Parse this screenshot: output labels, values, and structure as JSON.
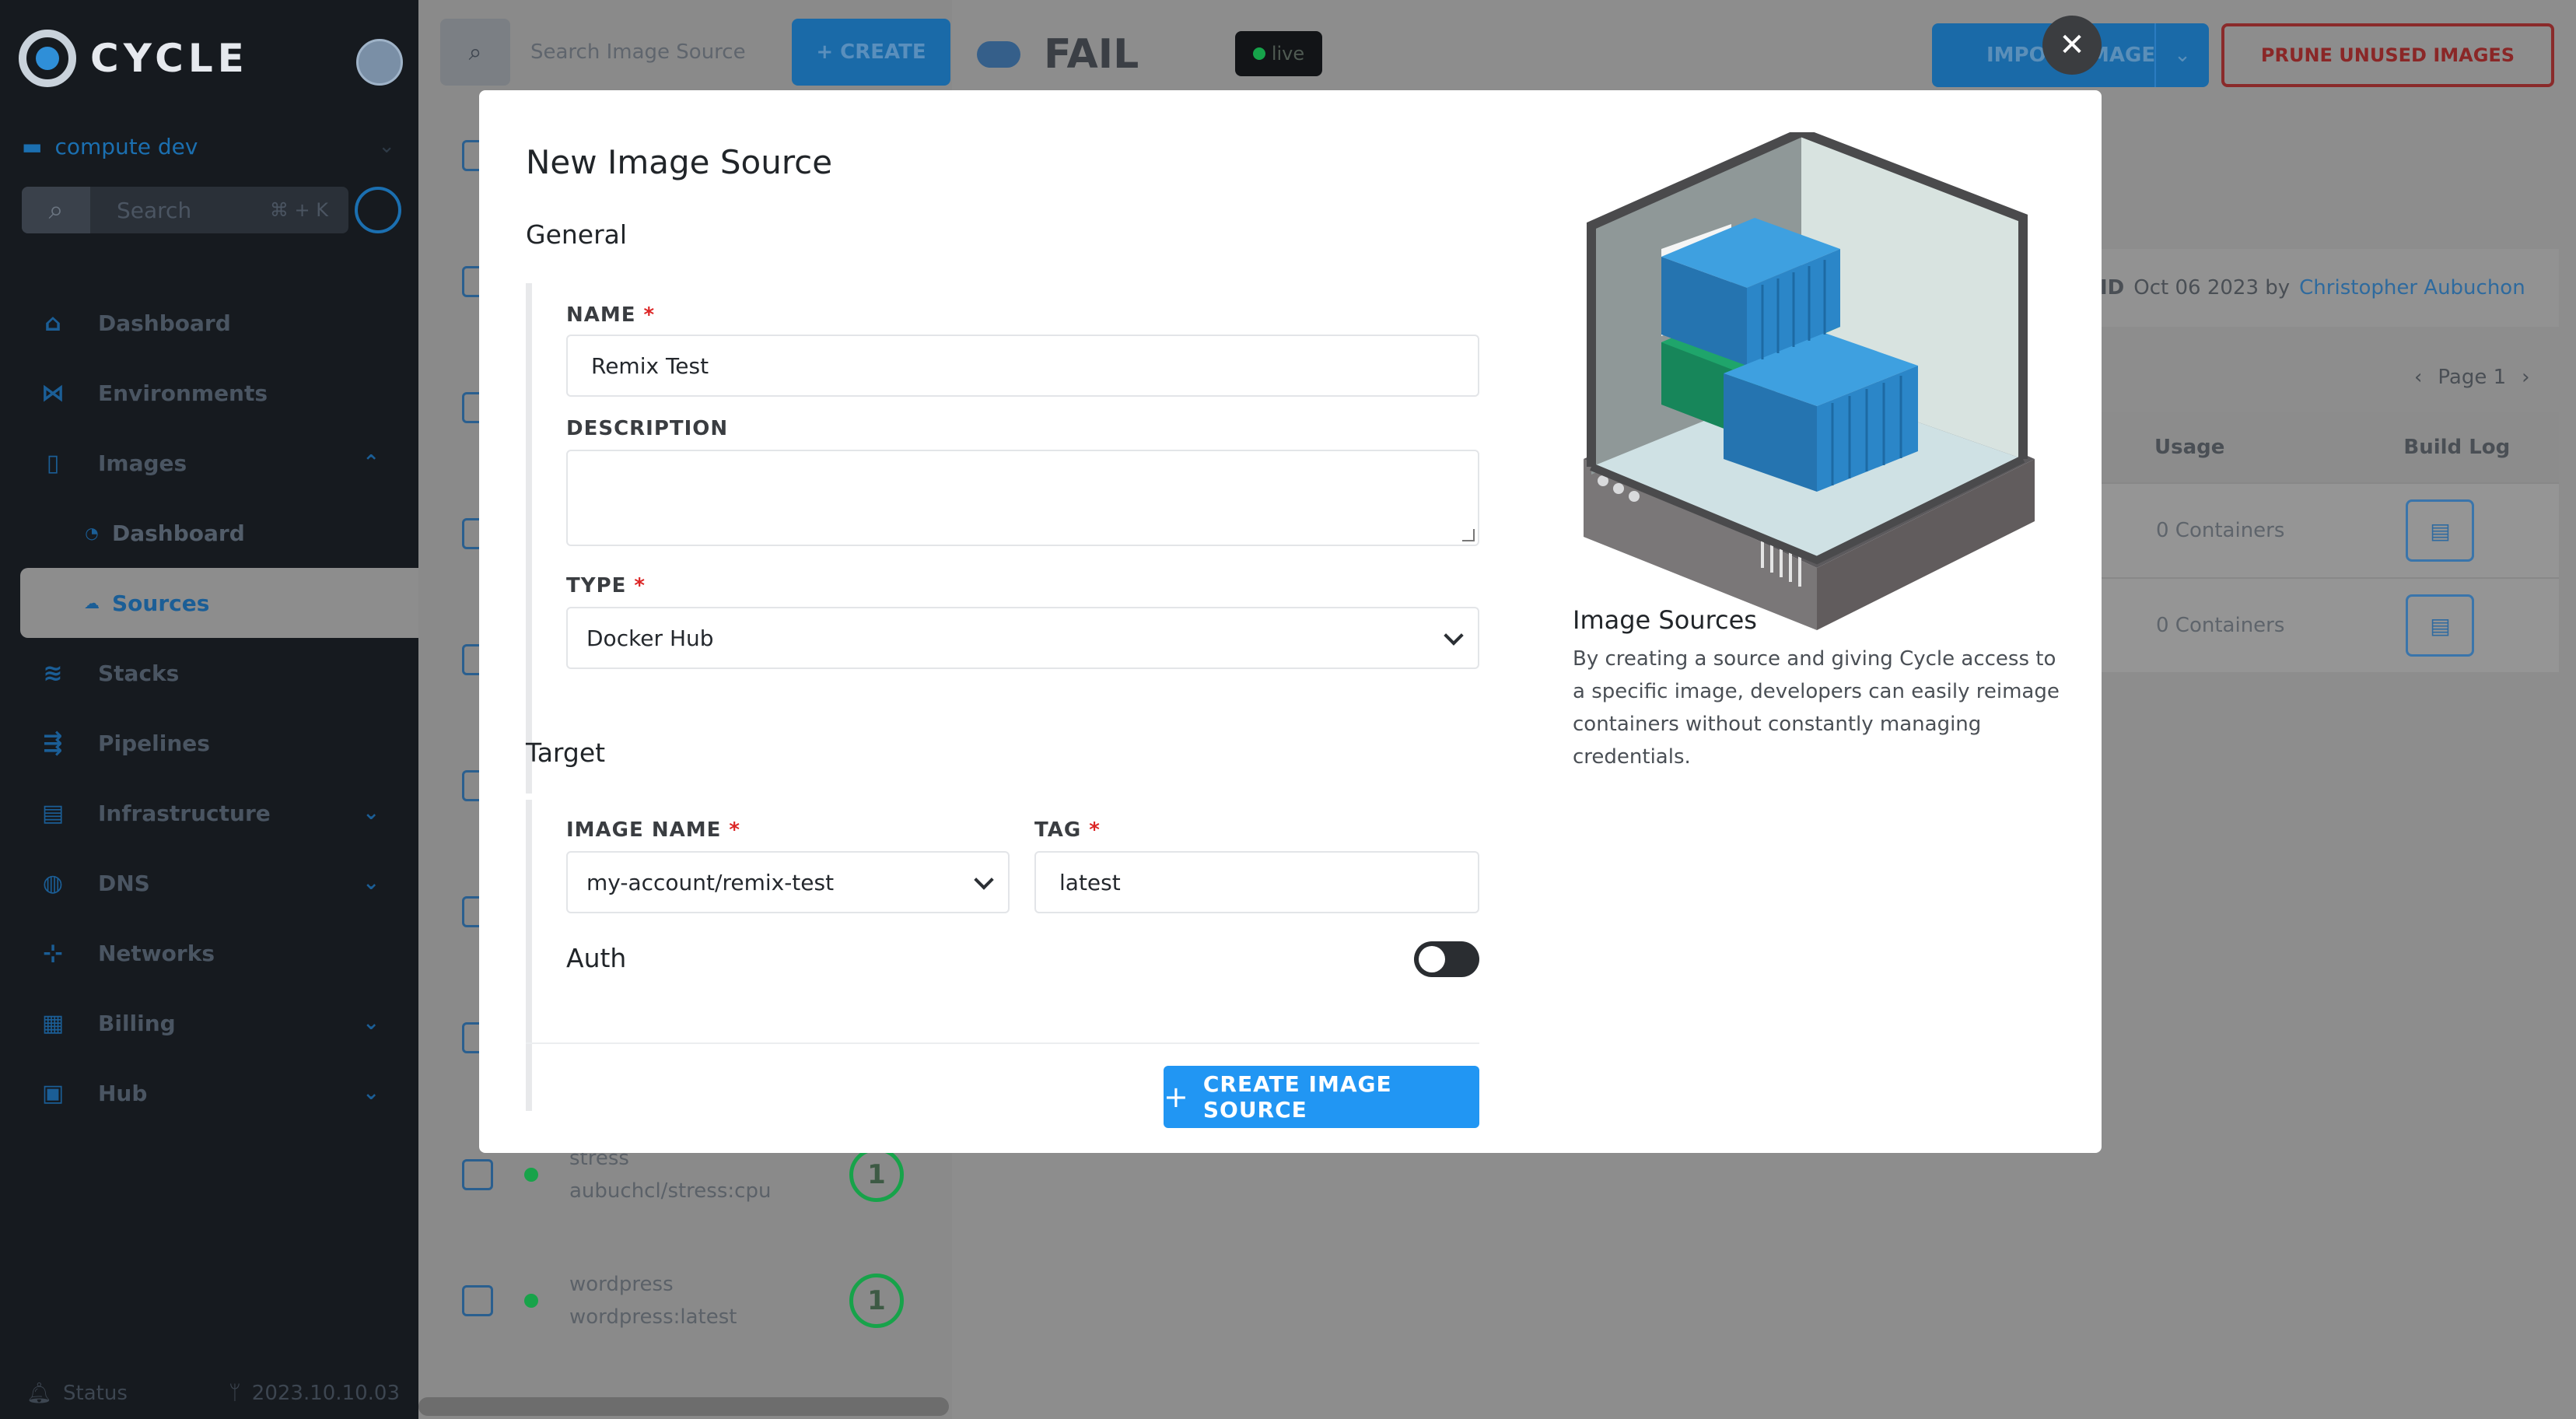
{
  "app": {
    "logo_text": "CYCLE",
    "environment": "compute dev",
    "search_placeholder": "Search",
    "search_shortcut": "⌘ + K",
    "nav": [
      {
        "label": "Dashboard",
        "icon": "home-icon"
      },
      {
        "label": "Environments",
        "icon": "environments-icon"
      },
      {
        "label": "Images",
        "icon": "images-icon",
        "expanded": true
      },
      {
        "label": "Dashboard",
        "icon": "dashboard-icon",
        "sub": true
      },
      {
        "label": "Sources",
        "icon": "cloud-icon",
        "sub": true,
        "active": true
      },
      {
        "label": "Stacks",
        "icon": "stacks-icon"
      },
      {
        "label": "Pipelines",
        "icon": "pipelines-icon"
      },
      {
        "label": "Infrastructure",
        "icon": "infrastructure-icon"
      },
      {
        "label": "DNS",
        "icon": "dns-icon"
      },
      {
        "label": "Networks",
        "icon": "networks-icon"
      },
      {
        "label": "Billing",
        "icon": "billing-icon"
      },
      {
        "label": "Hub",
        "icon": "hub-icon"
      }
    ],
    "footer": {
      "status": "Status",
      "version": "2023.10.10.03"
    }
  },
  "list": {
    "search_placeholder": "Search Image Source",
    "create_label": "+ CREATE",
    "rows": [
      {
        "name": "stress",
        "image": "aubuchcl/stress:cpu",
        "count": "1"
      },
      {
        "name": "wordpress",
        "image": "wordpress:latest",
        "count": "1"
      }
    ]
  },
  "detail": {
    "title": "FAIL",
    "live_label": "live",
    "import_label": "IMPORT IMAGE",
    "prune_label": "PRUNE UNUSED IMAGES",
    "meta_prefix": "ID",
    "meta_date": "Oct 06 2023 by",
    "meta_author": "Christopher Aubuchon",
    "page_label": "Page 1",
    "columns": {
      "usage": "Usage",
      "build_log": "Build Log"
    },
    "rows": [
      {
        "usage": "0 Containers"
      },
      {
        "usage": "0 Containers"
      }
    ]
  },
  "modal": {
    "title": "New Image Source",
    "general_title": "General",
    "name_label": "NAME",
    "name_value": "Remix Test",
    "description_label": "DESCRIPTION",
    "description_value": "",
    "type_label": "TYPE",
    "type_value": "Docker Hub",
    "target_title": "Target",
    "image_name_label": "IMAGE NAME",
    "image_name_value": "my-account/remix-test",
    "tag_label": "TAG",
    "tag_value": "latest",
    "auth_label": "Auth",
    "auth_enabled": false,
    "create_label": "CREATE IMAGE SOURCE",
    "close_icon": "close-icon",
    "info_title": "Image Sources",
    "info_text": "By creating a source and giving Cycle access to a specific image, developers can easily reimage containers without constantly managing credentials.",
    "colors": {
      "primary": "#2196f3",
      "required": "#dc2626"
    }
  }
}
